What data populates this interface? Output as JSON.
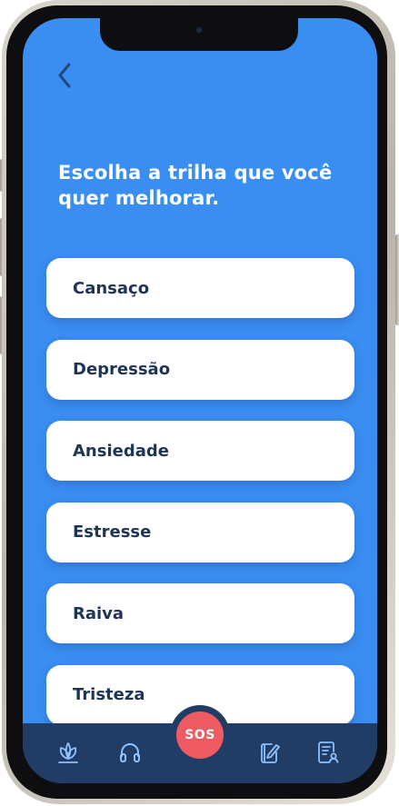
{
  "header": {
    "back_icon": "chevron-left-icon",
    "title": "Escolha a trilha que você quer melhorar."
  },
  "options": [
    {
      "label": "Cansaço"
    },
    {
      "label": "Depressão"
    },
    {
      "label": "Ansiedade"
    },
    {
      "label": "Estresse"
    },
    {
      "label": "Raiva"
    },
    {
      "label": "Tristeza"
    }
  ],
  "bottom_nav": {
    "items": [
      {
        "icon": "plant-icon"
      },
      {
        "icon": "headphones-icon"
      },
      {
        "icon": "journal-edit-icon"
      },
      {
        "icon": "report-profile-icon"
      }
    ],
    "sos_label": "SOS"
  },
  "colors": {
    "background": "#3a8df1",
    "card": "#ffffff",
    "card_text": "#1f3556",
    "nav_background": "#213d66",
    "nav_icon": "#8ec1ff",
    "sos": "#ef5b63"
  }
}
